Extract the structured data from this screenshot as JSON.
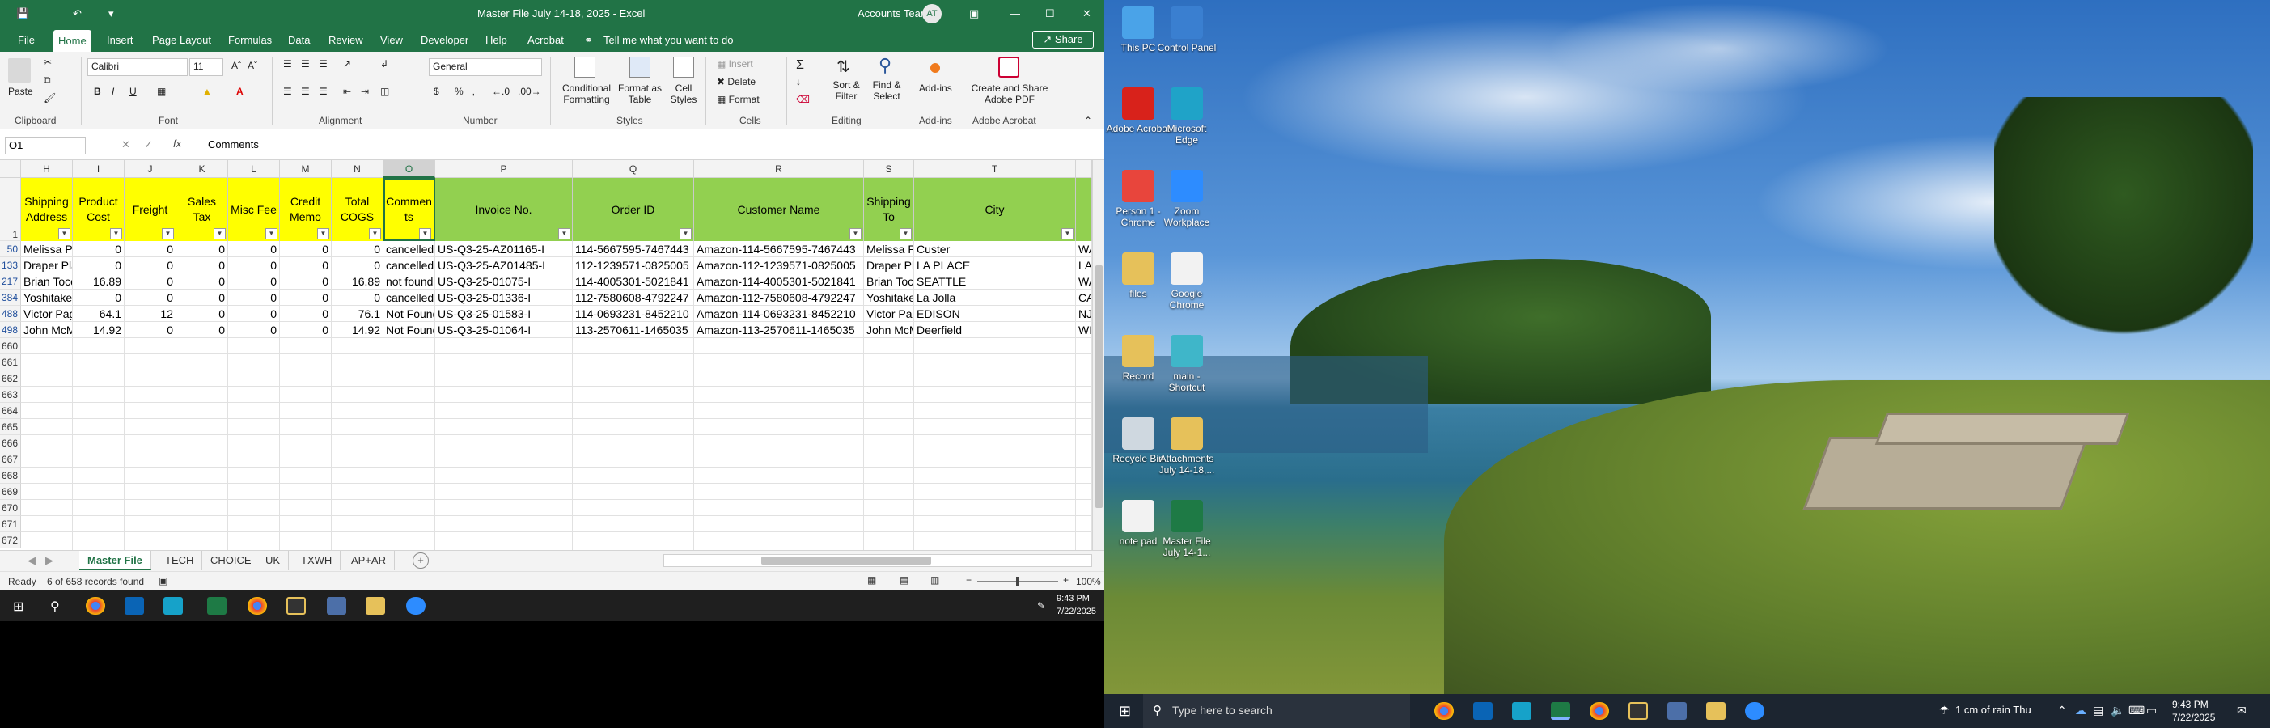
{
  "excel": {
    "title": "Master File July 14-18, 2025  -  Excel",
    "account": "Accounts Team",
    "account_initials": "AT",
    "menu": [
      "File",
      "Home",
      "Insert",
      "Page Layout",
      "Formulas",
      "Data",
      "Review",
      "View",
      "Developer",
      "Help",
      "Acrobat"
    ],
    "tell_me": "Tell me what you want to do",
    "share": "Share",
    "ribbon": {
      "paste": "Paste",
      "clipboard": "Clipboard",
      "font_name": "Calibri",
      "font_size": "11",
      "font": "Font",
      "alignment": "Alignment",
      "number_format": "General",
      "number": "Number",
      "conditional_formatting": "Conditional Formatting",
      "format_as_table": "Format as Table",
      "cell_styles": "Cell Styles",
      "styles": "Styles",
      "insert": "Insert",
      "delete": "Delete",
      "format": "Format",
      "cells": "Cells",
      "sort_filter": "Sort & Filter",
      "find_select": "Find & Select",
      "editing": "Editing",
      "add_ins": "Add-ins",
      "add_ins_group": "Add-ins",
      "create_share_pdf": "Create and Share Adobe PDF",
      "adobe_acrobat": "Adobe Acrobat",
      "bold": "B",
      "italic": "I",
      "underline": "U"
    },
    "name_box": "O1",
    "formula": "Comments",
    "fx": "fx",
    "columns": [
      "H",
      "I",
      "J",
      "K",
      "L",
      "M",
      "N",
      "O",
      "P",
      "Q",
      "R",
      "S",
      "T"
    ],
    "headers": {
      "H": "Shipping Address",
      "I": "Product Cost",
      "J": "Freight",
      "K": "Sales Tax",
      "L": "Misc Fee",
      "M": "Credit Memo",
      "N": "Total COGS",
      "O": "Commen ts",
      "P": "Invoice No.",
      "Q": "Order ID",
      "R": "Customer Name",
      "S": "Shipping To",
      "T": "City"
    },
    "rows": [
      {
        "row": "50",
        "H": "Melissa Pe",
        "I": "0",
        "J": "0",
        "K": "0",
        "L": "0",
        "M": "0",
        "N": "0",
        "O": "cancelled",
        "P": "US-Q3-25-AZ01165-I",
        "Q": "114-5667595-7467443",
        "R": "Amazon-114-5667595-7467443",
        "S": "Melissa Pe",
        "T": "Custer",
        "U": "WA"
      },
      {
        "row": "133",
        "H": "Draper Pla",
        "I": "0",
        "J": "0",
        "K": "0",
        "L": "0",
        "M": "0",
        "N": "0",
        "O": "cancelled",
        "P": "US-Q3-25-AZ01485-I",
        "Q": "112-1239571-0825005",
        "R": "Amazon-112-1239571-0825005",
        "S": "Draper Pla",
        "T": "LA PLACE",
        "U": "LA"
      },
      {
        "row": "217",
        "H": "Brian Tocc",
        "I": "16.89",
        "J": "0",
        "K": "0",
        "L": "0",
        "M": "0",
        "N": "16.89",
        "O": "not found",
        "P": "US-Q3-25-01075-I",
        "Q": "114-4005301-5021841",
        "R": "Amazon-114-4005301-5021841",
        "S": "Brian Tocc",
        "T": "SEATTLE",
        "U": "WA"
      },
      {
        "row": "384",
        "H": "Yoshitake",
        "I": "0",
        "J": "0",
        "K": "0",
        "L": "0",
        "M": "0",
        "N": "0",
        "O": "cancelled",
        "P": "US-Q3-25-01336-I",
        "Q": "112-7580608-4792247",
        "R": "Amazon-112-7580608-4792247",
        "S": "Yoshitake",
        "T": "La Jolla",
        "U": "CA"
      },
      {
        "row": "488",
        "H": "Victor Pag",
        "I": "64.1",
        "J": "12",
        "K": "0",
        "L": "0",
        "M": "0",
        "N": "76.1",
        "O": "Not Found",
        "P": "US-Q3-25-01583-I",
        "Q": "114-0693231-8452210",
        "R": "Amazon-114-0693231-8452210",
        "S": "Victor Pag",
        "T": "EDISON",
        "U": "NJ"
      },
      {
        "row": "498",
        "H": "John McM",
        "I": "14.92",
        "J": "0",
        "K": "0",
        "L": "0",
        "M": "0",
        "N": "14.92",
        "O": "Not Found",
        "P": "US-Q3-25-01064-I",
        "Q": "113-2570611-1465035",
        "R": "Amazon-113-2570611-1465035",
        "S": "John McM",
        "T": "Deerfield",
        "U": "WI"
      }
    ],
    "header_row": "1",
    "empty_rows": [
      "660",
      "661",
      "662",
      "663",
      "664",
      "665",
      "666",
      "667",
      "668",
      "669",
      "670",
      "671",
      "672"
    ],
    "sheet_tabs": [
      "Master File",
      "TECH",
      "CHOICE",
      "UK",
      "TXWH",
      "AP+AR"
    ],
    "status_ready": "Ready",
    "status_records": "6 of 658 records found",
    "zoom": "100%",
    "clock_time": "9:43 PM",
    "clock_date": "7/22/2025"
  },
  "desktop": {
    "icons": [
      {
        "label": "This PC",
        "color": "#4aa3e8"
      },
      {
        "label": "Control Panel",
        "color": "#3a7fd0"
      },
      {
        "label": "Adobe Acrobat",
        "color": "#d8221b"
      },
      {
        "label": "Microsoft Edge",
        "color": "#1fa3c8"
      },
      {
        "label": "Person 1 - Chrome",
        "color": "#e8453c"
      },
      {
        "label": "Zoom Workplace",
        "color": "#2d8cff"
      },
      {
        "label": "files",
        "color": "#e6c15a"
      },
      {
        "label": "Google Chrome",
        "color": "#f2f2f2"
      },
      {
        "label": "Record",
        "color": "#e6c15a"
      },
      {
        "label": "main - Shortcut",
        "color": "#3fb6c9"
      },
      {
        "label": "Recycle Bin",
        "color": "#cfd8e0"
      },
      {
        "label": "Attachments July 14-18,...",
        "color": "#e6c15a"
      },
      {
        "label": "note pad",
        "color": "#f2f2f2"
      },
      {
        "label": "Master File July 14-1...",
        "color": "#1e7a45"
      }
    ],
    "search_placeholder": "Type here to search",
    "weather": "1 cm of rain Thu",
    "clock_time": "9:43 PM",
    "clock_date": "7/22/2025"
  }
}
